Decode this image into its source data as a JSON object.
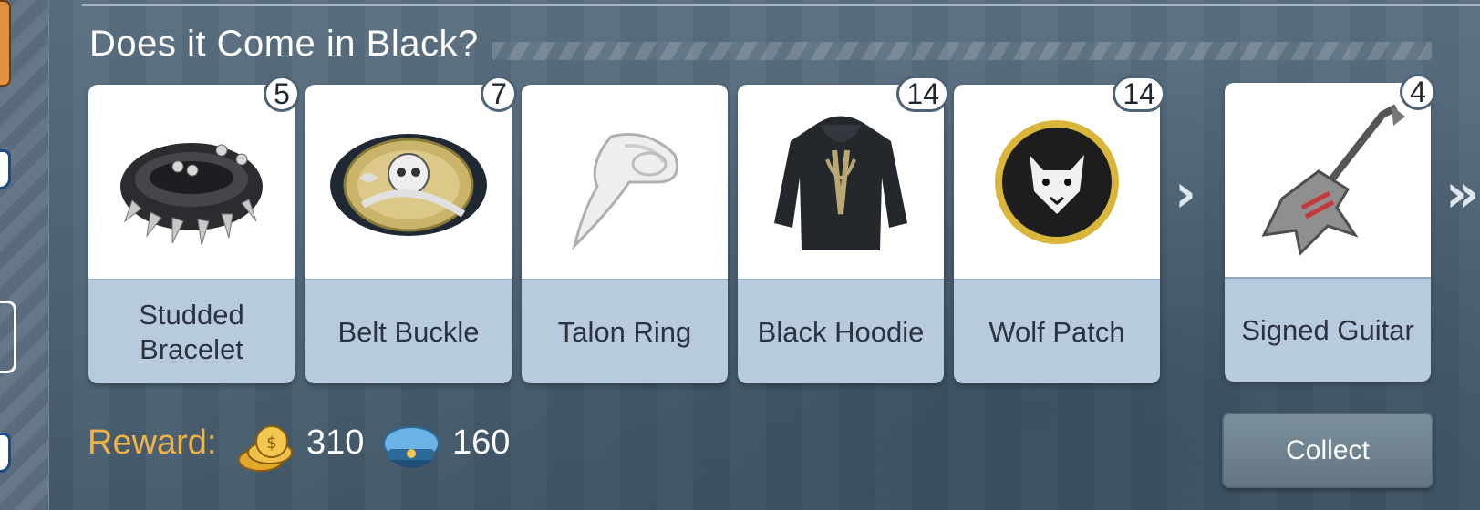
{
  "quest": {
    "title": "Does it Come in Black?",
    "items": [
      {
        "name_line1": "Studded",
        "name_line2": "Bracelet",
        "count": "5",
        "icon": "studded-bracelet-icon"
      },
      {
        "name_line1": "Belt Buckle",
        "name_line2": "",
        "count": "7",
        "icon": "belt-buckle-icon"
      },
      {
        "name_line1": "Talon Ring",
        "name_line2": "",
        "count": "",
        "icon": "talon-ring-icon"
      },
      {
        "name_line1": "Black Hoodie",
        "name_line2": "",
        "count": "14",
        "icon": "black-hoodie-icon"
      },
      {
        "name_line1": "Wolf Patch",
        "name_line2": "",
        "count": "14",
        "icon": "wolf-patch-icon"
      },
      {
        "name_line1": "Signed Guitar",
        "name_line2": "",
        "count": "4",
        "icon": "signed-guitar-icon"
      }
    ],
    "arrow_single": "›",
    "arrow_double": "»"
  },
  "reward": {
    "label": "Reward:",
    "coins": "310",
    "hats": "160",
    "coin_icon": "gold-coins-icon",
    "hat_icon": "police-cap-icon"
  },
  "actions": {
    "collect_label": "Collect"
  },
  "colors": {
    "reward_label": "#f0b34a",
    "card_footer": "#b8cade",
    "background": "#4f6577"
  }
}
